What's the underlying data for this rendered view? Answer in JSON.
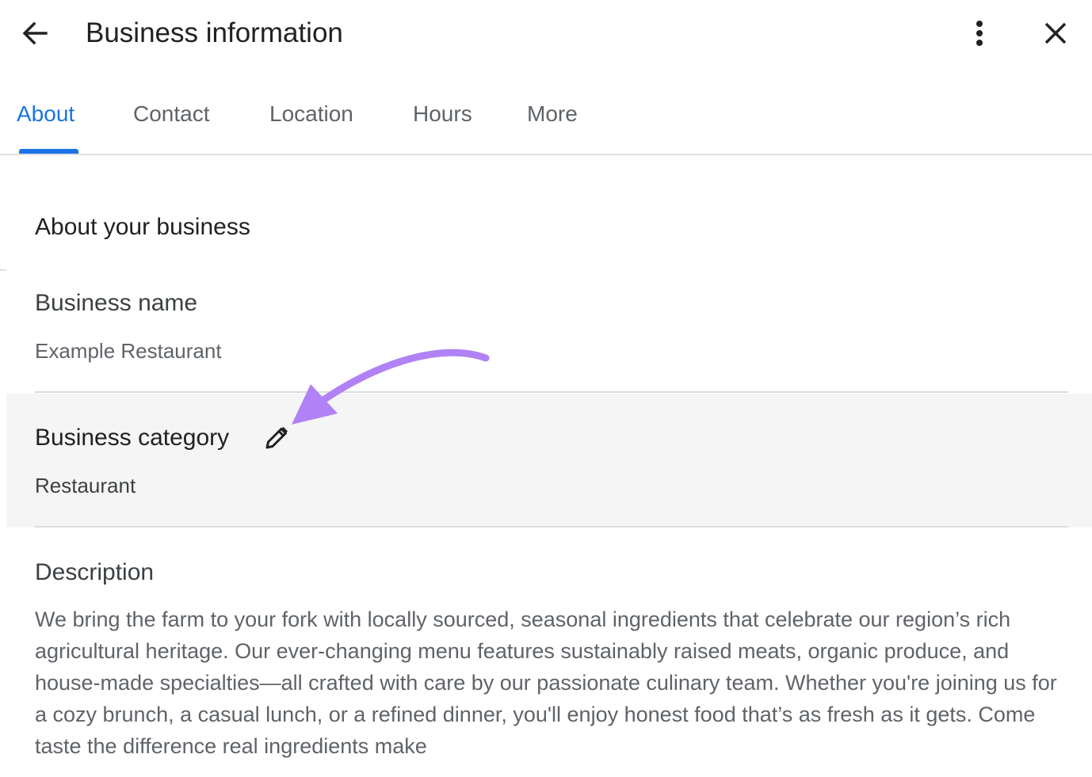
{
  "header": {
    "title": "Business information",
    "back_icon": "arrow-back-icon",
    "more_icon": "more-vert-icon",
    "close_icon": "close-icon"
  },
  "tabs": [
    {
      "label": "About",
      "active": true
    },
    {
      "label": "Contact",
      "active": false
    },
    {
      "label": "Location",
      "active": false
    },
    {
      "label": "Hours",
      "active": false
    },
    {
      "label": "More",
      "active": false
    }
  ],
  "about": {
    "section_title": "About your business",
    "business_name": {
      "label": "Business name",
      "value": "Example Restaurant"
    },
    "business_category": {
      "label": "Business category",
      "value": "Restaurant",
      "edit_icon": "pencil-icon"
    },
    "description": {
      "label": "Description",
      "value": "We bring the farm to your fork with locally sourced, seasonal ingredients that celebrate our region’s rich agricultural heritage. Our ever-changing menu features sustainably raised meats, organic produce, and house-made specialties—all crafted with care by our passionate culinary team. Whether you're joining us for a cozy brunch, a casual lunch, or a refined dinner, you'll enjoy honest food that’s as fresh as it gets. Come taste the difference real ingredients make"
    }
  },
  "colors": {
    "accent": "#1a73e8",
    "annotation_arrow": "#b082f5",
    "highlight_row": "#f5f5f5"
  }
}
